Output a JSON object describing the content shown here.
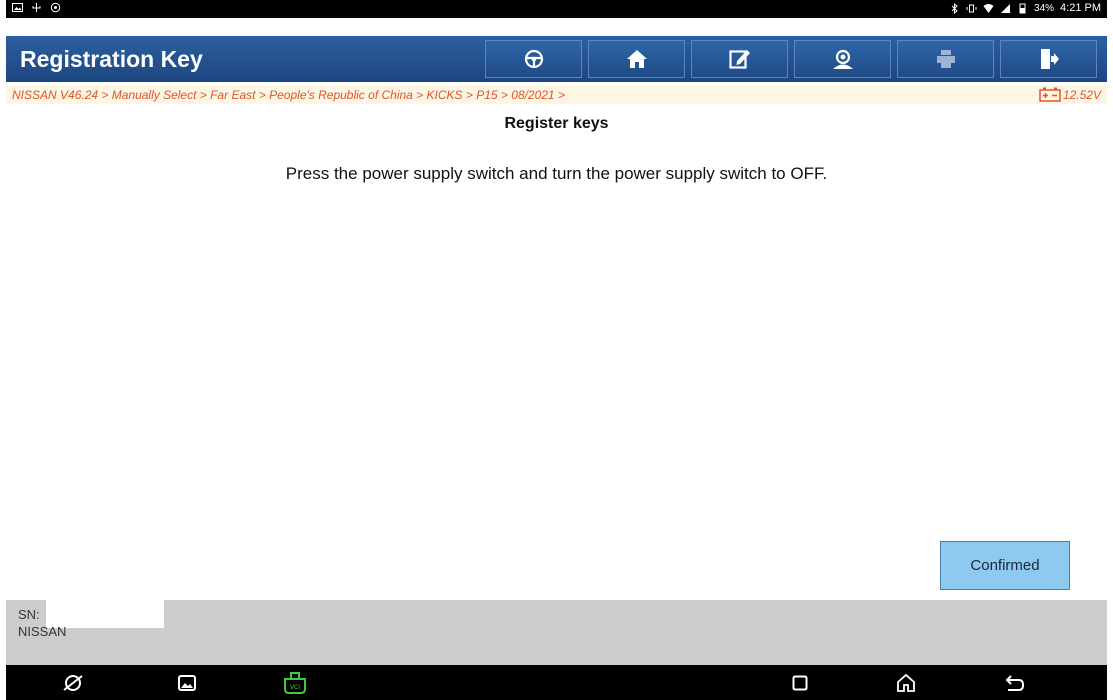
{
  "status_bar": {
    "battery_pct": "34%",
    "time": "4:21 PM"
  },
  "header": {
    "title": "Registration Key",
    "toolbar": [
      {
        "name": "steering-wheel-icon"
      },
      {
        "name": "home-icon"
      },
      {
        "name": "edit-icon"
      },
      {
        "name": "support-icon"
      },
      {
        "name": "print-icon"
      },
      {
        "name": "exit-icon"
      }
    ]
  },
  "breadcrumb": {
    "path": "NISSAN V46.24 > Manually Select > Far East > People's Republic of China > KICKS > P15 > 08/2021 >",
    "voltage": "12.52V"
  },
  "main": {
    "title": "Register keys",
    "message": "Press the power supply switch and turn the power supply switch to OFF."
  },
  "actions": {
    "confirm_label": "Confirmed"
  },
  "footer": {
    "sn_label": "SN:",
    "make": "NISSAN"
  },
  "colors": {
    "header_blue": "#1d4680",
    "breadcrumb_orange": "#e0552b",
    "confirm_button": "#8ec9ef",
    "footer_gray": "#cccccc"
  }
}
